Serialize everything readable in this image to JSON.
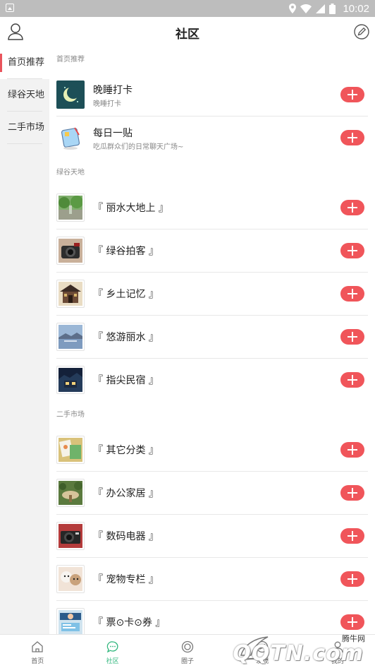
{
  "status_bar": {
    "time": "10:02"
  },
  "header": {
    "title": "社区"
  },
  "sidebar": {
    "items": [
      {
        "label": "首页推荐",
        "active": true
      },
      {
        "label": "绿谷天地",
        "active": false
      },
      {
        "label": "二手市场",
        "active": false
      }
    ]
  },
  "sections": [
    {
      "title": "首页推荐",
      "items": [
        {
          "name": "晚睡打卡",
          "sub": "晚睡打卡",
          "thumb": "moon-night"
        },
        {
          "name": "每日一贴",
          "sub": "吃瓜群众们的日常聊天广场~",
          "thumb": "sticky-note"
        }
      ]
    },
    {
      "title": "绿谷天地",
      "items": [
        {
          "name": "『 丽水大地上 』",
          "thumb": "green-street"
        },
        {
          "name": "『 绿谷拍客 』",
          "thumb": "camera"
        },
        {
          "name": "『 乡土记忆 』",
          "thumb": "old-building"
        },
        {
          "name": "『 悠游丽水 』",
          "thumb": "lake-scenery"
        },
        {
          "name": "『 指尖民宿 』",
          "thumb": "night-house"
        }
      ]
    },
    {
      "title": "二手市场",
      "items": [
        {
          "name": "『 其它分类 』",
          "thumb": "misc-items"
        },
        {
          "name": "『 办公家居 』",
          "thumb": "garden-table"
        },
        {
          "name": "『 数码电器 』",
          "thumb": "digital-camera"
        },
        {
          "name": "『 宠物专栏 』",
          "thumb": "pets"
        },
        {
          "name": "『 票⊙卡⊙券 』",
          "thumb": "tickets"
        }
      ]
    }
  ],
  "tabbar": {
    "tabs": [
      {
        "label": "首页",
        "active": false
      },
      {
        "label": "社区",
        "active": true
      },
      {
        "label": "圈子",
        "active": false
      },
      {
        "label": "发现",
        "active": false
      },
      {
        "label": "我的",
        "active": false
      }
    ]
  },
  "watermark": {
    "small": "腾牛网",
    "big": "QQTN.com"
  },
  "colors": {
    "accent_red": "#f0555a",
    "active_green": "#2cb57a",
    "sidebar_bg": "#f2f2f2"
  }
}
